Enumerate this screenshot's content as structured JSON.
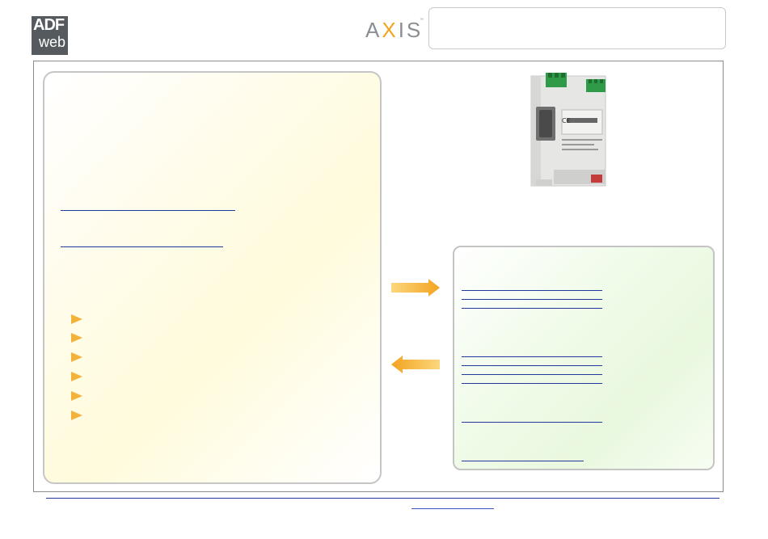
{
  "header": {
    "logo_adf_line1": "ADF",
    "logo_adf_line2": "web",
    "logo_axis_left": "A",
    "logo_axis_x": "X",
    "logo_axis_right": "IS",
    "logo_axis_tm": "™"
  },
  "colors": {
    "adf_logo_bg": "#555a5e",
    "axis_orange": "#f3a31f",
    "link_blue": "#1f3a9a",
    "left_panel_tint": "#fffbdc",
    "right_panel_tint": "#e9f8df",
    "arrow_orange": "#f5b43a"
  },
  "icons": {
    "bullet": "orange-triangle-icon",
    "arrow_right": "arrow-right-icon",
    "arrow_left": "arrow-left-icon"
  },
  "left_panel": {
    "bullet_count": 6
  }
}
